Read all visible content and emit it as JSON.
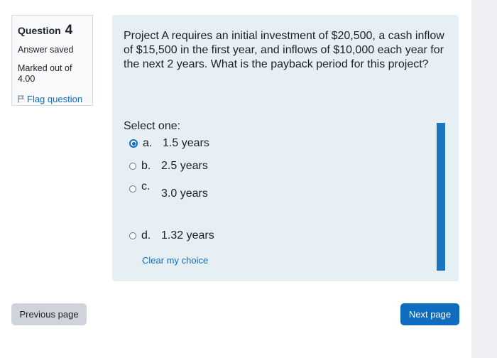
{
  "info": {
    "question_label": "Question",
    "question_number": "4",
    "state": "Answer saved",
    "marked": "Marked out of 4.00",
    "flag_label": "Flag question"
  },
  "question": {
    "text": "Project A requires an initial investment of $20,500, a cash inflow of $15,500 in the first year, and inflows of $10,000 each year for the next 2 years. What is the payback period for this project?",
    "select_label": "Select one:",
    "options": [
      {
        "letter": "a.",
        "text": "1.5 years",
        "selected": true
      },
      {
        "letter": "b.",
        "text": "2.5 years",
        "selected": false
      },
      {
        "letter": "c.",
        "text": "3.0 years",
        "selected": false
      },
      {
        "letter": "d.",
        "text": "1.32 years",
        "selected": false
      }
    ],
    "clear_label": "Clear my choice"
  },
  "nav": {
    "previous_label": "Previous page",
    "next_label": "Next page"
  },
  "colors": {
    "accent": "#0f6cbf",
    "content_bg": "#e6f0f4",
    "info_bg": "#f8f9fa",
    "secondary_button": "#ced4da"
  },
  "icons": {
    "flag": "flag-icon"
  }
}
